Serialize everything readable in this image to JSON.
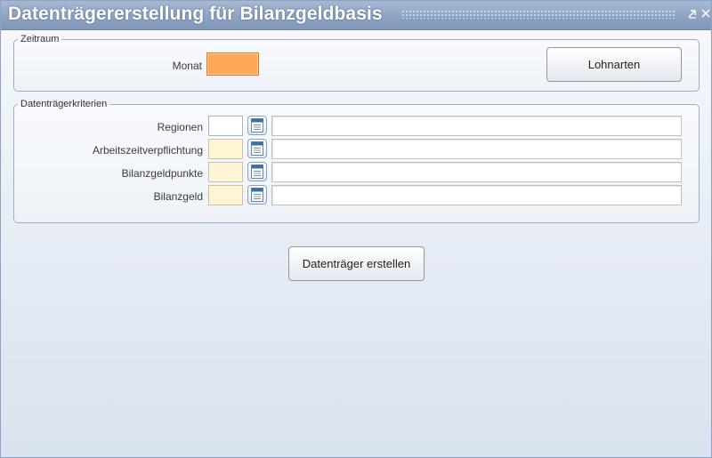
{
  "window": {
    "title": "Datenträgererstellung für Bilanzgeldbasis"
  },
  "zeitraum": {
    "legend": "Zeitraum",
    "monat_label": "Monat",
    "monat_value": "",
    "lohnarten_button": "Lohnarten"
  },
  "kriterien": {
    "legend": "Datenträgerkriterien",
    "rows": [
      {
        "label": "Regionen",
        "code": "",
        "description": ""
      },
      {
        "label": "Arbeitszeitverpflichtung",
        "code": "",
        "description": ""
      },
      {
        "label": "Bilanzgeldpunkte",
        "code": "",
        "description": ""
      },
      {
        "label": "Bilanzgeld",
        "code": "",
        "description": ""
      }
    ]
  },
  "actions": {
    "create_button": "Datenträger erstellen"
  },
  "colors": {
    "title_bar": "#8fa4c3",
    "focused_field": "#ffa85a",
    "required_field": "#fff4d4"
  }
}
